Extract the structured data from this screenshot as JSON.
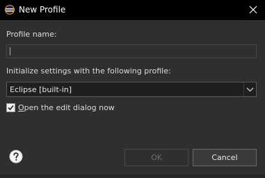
{
  "window": {
    "title": "New Profile",
    "icon": "eclipse-icon",
    "close_icon": "close-icon"
  },
  "form": {
    "profile_name_label": "Profile name:",
    "profile_name_value": "",
    "init_label": "Initialize settings with the following profile:",
    "profile_select": {
      "selected": "Eclipse [built-in]"
    },
    "open_edit_dialog": {
      "label_prefix": "",
      "label_mnemonic": "O",
      "label_rest": "pen the edit dialog now",
      "checked": true
    }
  },
  "footer": {
    "help_icon": "help-icon",
    "ok_label": "OK",
    "ok_enabled": false,
    "cancel_label": "Cancel"
  },
  "colors": {
    "titlebar": "#000000",
    "dialog_bg": "#2f2f2f",
    "text": "#dcdcdc",
    "disabled_text": "#6e6e6e"
  }
}
